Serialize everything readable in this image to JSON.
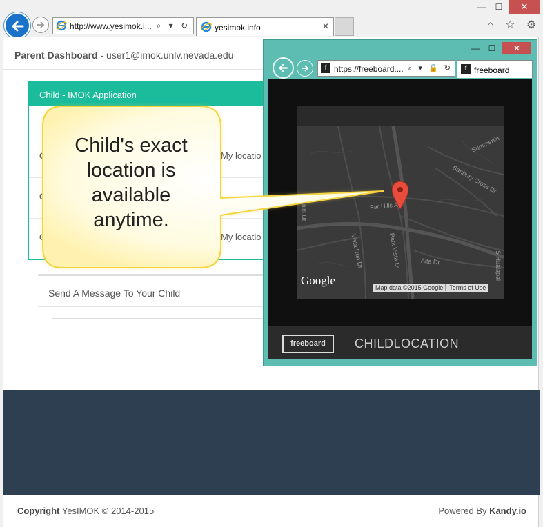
{
  "browser": {
    "address": "http://www.yesimok.i...",
    "tab_title": "yesimok.info",
    "window_controls": {
      "minimize": "—",
      "maximize": "☐",
      "close": "✕"
    },
    "address_tools": "⌕ ▾ ↻",
    "right_icons": "⌂ ☆ ⚙",
    "tab_close": "✕"
  },
  "page": {
    "dashboard_title": "Parent Dashboard",
    "dashboard_email": " - user1@imok.unlv.nevada.edu",
    "child_card": {
      "header": "Child - IMOK Application",
      "rows": [
        {
          "label": "C",
          "location": "My locatio"
        },
        {
          "label": "C",
          "location": ""
        },
        {
          "label": "C",
          "location": "My locatio"
        }
      ]
    },
    "message": {
      "label": "Send A Message To Your Child"
    },
    "footer": {
      "copyright_bold": "Copyright",
      "copyright_text": " YesIMOK © 2014-2015",
      "powered_text": "Powered By ",
      "powered_bold": "Kandy.io"
    }
  },
  "popup": {
    "address": "https://freeboard....",
    "address_tools": "⌕ ▾ 🔒 ↻",
    "tab_title": "freeboard",
    "favicon": "f",
    "window_controls": {
      "minimize": "—",
      "maximize": "☐",
      "close": "✕"
    },
    "map": {
      "labels": [
        "Summerlin",
        "Banbury Cross Dr",
        "Far Hills Ave",
        "Vista Run Dr",
        "Park Vista Dr",
        "Alta Dr",
        "S Hualapai",
        "Hills Ut"
      ],
      "logo": "Google",
      "attribution": "Map data ©2015 Google",
      "terms": "Terms of Use"
    },
    "dashboard_logo": "freeboard",
    "dashboard_title": "CHILDLOCATION"
  },
  "callout": {
    "text_lines": [
      "Child's exact",
      "location is",
      "available",
      "anytime."
    ]
  },
  "colors": {
    "accent_teal": "#1abc9c",
    "popup_frame": "#5ebdb3",
    "dark_band": "#2f3f52",
    "callout_fill": "#fffbe0",
    "callout_border": "#f5d43f",
    "pin": "#e74c3c"
  }
}
